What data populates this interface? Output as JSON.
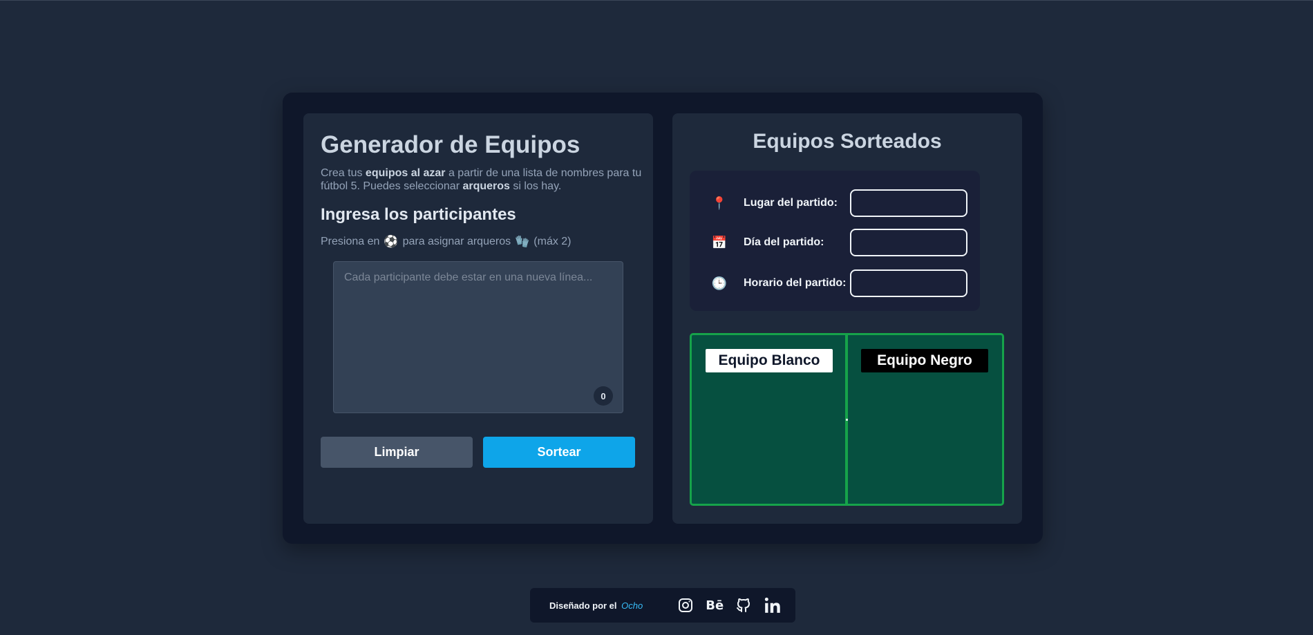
{
  "generator": {
    "title": "Generador de Equipos",
    "desc_pre": "Crea tus ",
    "desc_bold1": "equipos al azar",
    "desc_mid": " a partir de una lista de nombres para tu fútbol 5. Puedes seleccionar ",
    "desc_bold2": "arqueros",
    "desc_post": " si los hay.",
    "subtitle": "Ingresa los participantes",
    "hint_pre": "Presiona en",
    "hint_ball": "⚽",
    "hint_mid": "para asignar arqueros",
    "hint_glove": "🧤",
    "hint_post": "(máx 2)",
    "textarea_placeholder": "Cada participante debe estar en una nueva línea...",
    "counter": "0",
    "clear_label": "Limpiar",
    "sort_label": "Sortear"
  },
  "results": {
    "title": "Equipos Sorteados",
    "place_label": "Lugar del partido:",
    "day_label": "Día del partido:",
    "time_label": "Horario del partido:",
    "place_icon": "📍",
    "day_icon": "📅",
    "time_icon": "🕒",
    "team_white": "Equipo Blanco",
    "team_black": "Equipo Negro"
  },
  "footer": {
    "credit": "Diseñado por el",
    "author": "Ocho",
    "socials": [
      "instagram-icon",
      "behance-icon",
      "github-icon",
      "linkedin-icon"
    ],
    "behance_text": "Bē"
  },
  "colors": {
    "accent": "#0ea5e9",
    "pitch": "#065040",
    "pitch_line": "#16a34a"
  }
}
